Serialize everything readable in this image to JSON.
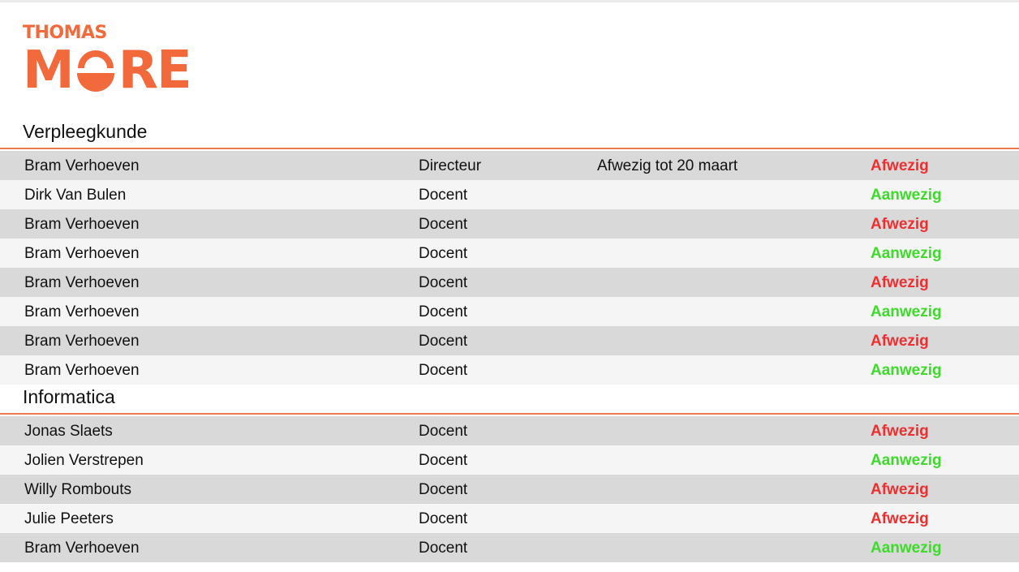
{
  "brand": {
    "line1": "THOMAS",
    "line2_left": "M",
    "line2_right": "RE",
    "color": "#f26a3c"
  },
  "colors": {
    "afwezig": "#ef2e2e",
    "aanwezig": "#3ddc2a",
    "divider": "#e87a52",
    "row_shade": "#d9d9d9",
    "row_light": "#f5f5f5"
  },
  "sections": [
    {
      "title": "Verpleegkunde",
      "rows": [
        {
          "name": "Bram Verhoeven",
          "role": "Directeur",
          "note": "Afwezig tot 20 maart",
          "status": "Afwezig"
        },
        {
          "name": "Dirk Van Bulen",
          "role": "Docent",
          "note": "",
          "status": "Aanwezig"
        },
        {
          "name": "Bram Verhoeven",
          "role": "Docent",
          "note": "",
          "status": "Afwezig"
        },
        {
          "name": "Bram Verhoeven",
          "role": "Docent",
          "note": "",
          "status": "Aanwezig"
        },
        {
          "name": "Bram Verhoeven",
          "role": "Docent",
          "note": "",
          "status": "Afwezig"
        },
        {
          "name": "Bram Verhoeven",
          "role": "Docent",
          "note": "",
          "status": "Aanwezig"
        },
        {
          "name": "Bram Verhoeven",
          "role": "Docent",
          "note": "",
          "status": "Afwezig"
        },
        {
          "name": "Bram Verhoeven",
          "role": "Docent",
          "note": "",
          "status": "Aanwezig"
        }
      ]
    },
    {
      "title": "Informatica",
      "rows": [
        {
          "name": "Jonas Slaets",
          "role": "Docent",
          "note": "",
          "status": "Afwezig"
        },
        {
          "name": "Jolien Verstrepen",
          "role": "Docent",
          "note": "",
          "status": "Aanwezig"
        },
        {
          "name": "Willy Rombouts",
          "role": "Docent",
          "note": "",
          "status": "Afwezig"
        },
        {
          "name": "Julie Peeters",
          "role": "Docent",
          "note": "",
          "status": "Afwezig"
        },
        {
          "name": "Bram Verhoeven",
          "role": "Docent",
          "note": "",
          "status": "Aanwezig"
        }
      ]
    }
  ]
}
